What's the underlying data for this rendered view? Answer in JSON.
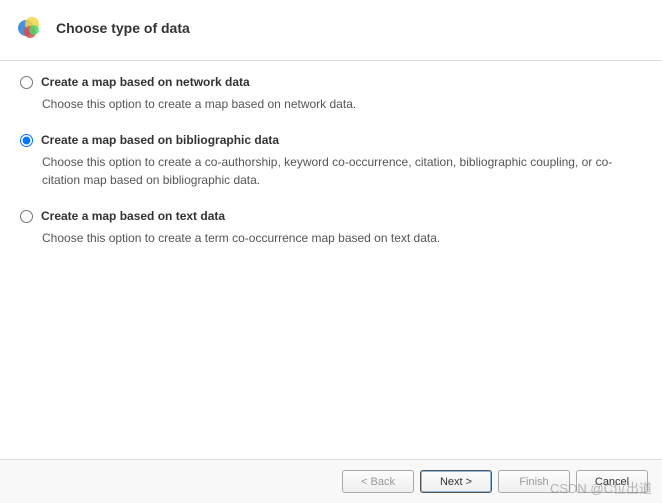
{
  "header": {
    "title": "Choose type of data"
  },
  "options": [
    {
      "label": "Create a map based on network data",
      "description": "Choose this option to create a map based on network data.",
      "selected": false
    },
    {
      "label": "Create a map based on bibliographic data",
      "description": "Choose this option to create a co-authorship, keyword co-occurrence, citation, bibliographic coupling, or co-citation map based on bibliographic data.",
      "selected": true
    },
    {
      "label": "Create a map based on text data",
      "description": "Choose this option to create a term co-occurrence map based on text data.",
      "selected": false
    }
  ],
  "buttons": {
    "back": "< Back",
    "next": "Next >",
    "finish": "Finish",
    "cancel": "Cancel"
  },
  "watermark": "CSDN @C位出道"
}
